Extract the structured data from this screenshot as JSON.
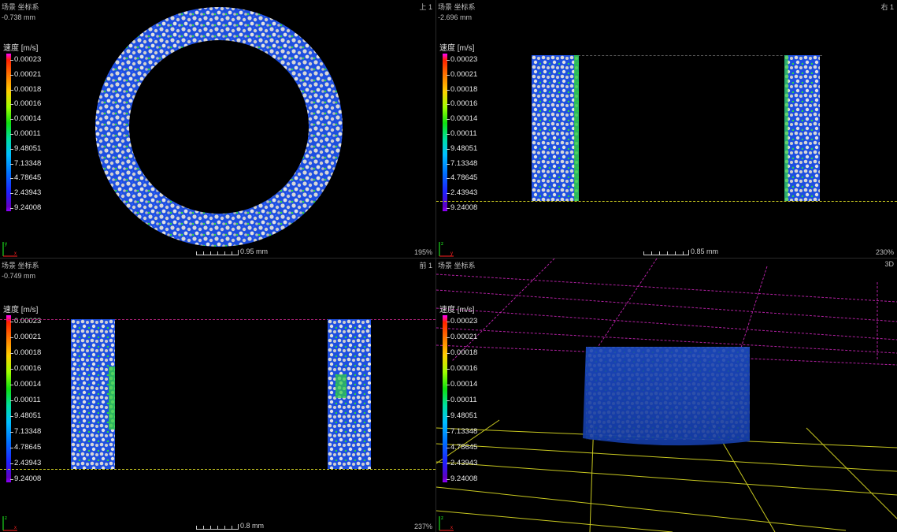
{
  "legend": {
    "title": "速度 [m/s]",
    "ticks": [
      "0.00023",
      "0.00021",
      "0.00018",
      "0.00016",
      "0.00014",
      "0.00011",
      "9.48051",
      "7.13348",
      "4.78645",
      "2.43943",
      "9.24008"
    ]
  },
  "viewports": {
    "top": {
      "scene": "场景 坐标系",
      "offset": "-0.738 mm",
      "name": "上 1",
      "scale": "0.95 mm",
      "zoom": "195%"
    },
    "right": {
      "scene": "场景 坐标系",
      "offset": "-2.696 mm",
      "name": "右 1",
      "scale": "0.85 mm",
      "zoom": "230%"
    },
    "front": {
      "scene": "场景 坐标系",
      "offset": "-0.749 mm",
      "name": "前 1",
      "scale": "0.8 mm",
      "zoom": "237%"
    },
    "three_d": {
      "scene": "场景 坐标系",
      "name": "3D"
    }
  },
  "colors": {
    "background": "#000000",
    "axis_x": "#ff2020",
    "axis_y": "#20ff20",
    "grid_floor": "#c8c820",
    "grid_top": "#c020a0",
    "speckle_low": "#1040e0",
    "speckle_mid": "#20c040",
    "speckle_high": "#e0e0e0"
  }
}
